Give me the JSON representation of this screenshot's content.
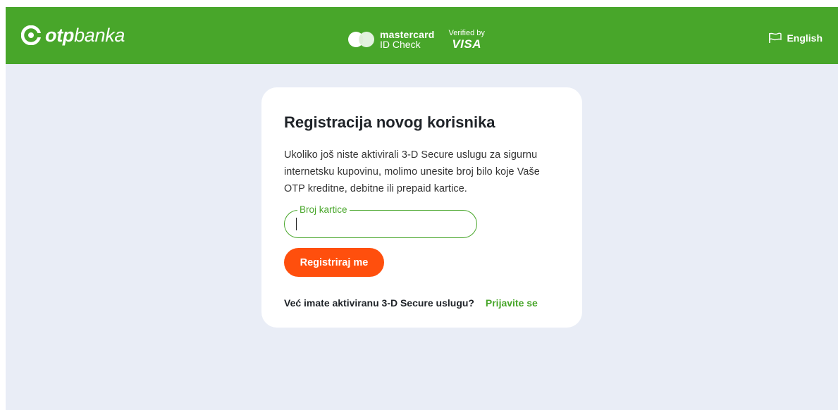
{
  "header": {
    "logo_bold": "otp",
    "logo_rest": "banka",
    "mastercard_name": "mastercard",
    "mastercard_sub": "ID Check",
    "visa_small": "Verified by",
    "visa_big": "VISA",
    "language_label": "English",
    "colors": {
      "green": "#48a62a",
      "mc_circle": "#ffffff"
    },
    "icons": [
      "otp-logo-icon",
      "mastercard-icon",
      "flag-icon"
    ]
  },
  "card": {
    "title": "Registracija novog korisnika",
    "description": "Ukoliko još niste aktivirali 3-D Secure uslugu za sigurnu internetsku kupovinu, molimo unesite broj bilo koje Vaše OTP kreditne, debitne ili prepaid kartice.",
    "field": {
      "label": "Broj kartice",
      "value": "",
      "placeholder": ""
    },
    "submit_label": "Registriraj me",
    "footer_question": "Već imate aktiviranu 3-D Secure uslugu?",
    "footer_link": "Prijavite se",
    "colors": {
      "accent": "#ff4f0d",
      "link": "#48a62a",
      "background": "#e9edf6"
    }
  }
}
